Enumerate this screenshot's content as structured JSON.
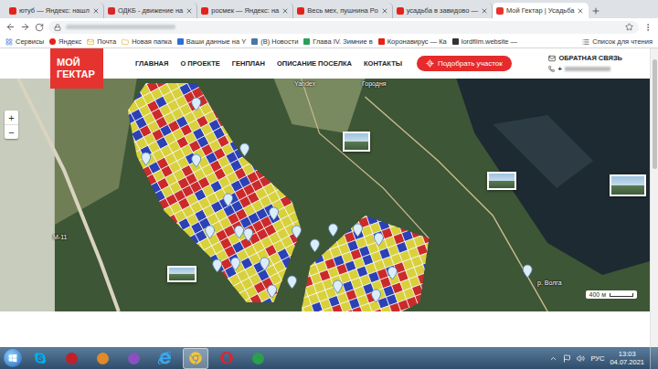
{
  "browser": {
    "tabs": [
      {
        "label": "ютуб — Яндекс: нашл",
        "selected": false
      },
      {
        "label": "ОДКБ - движение на",
        "selected": false
      },
      {
        "label": "росмек — Яндекс: на",
        "selected": false
      },
      {
        "label": "Весь мех, пушнина Ро",
        "selected": false
      },
      {
        "label": "усадьба в завидово —",
        "selected": false
      },
      {
        "label": "Мой Гектар | Усадьба",
        "selected": true
      }
    ],
    "bookmarks": [
      "Сервисы",
      "Яндекс",
      "Почта",
      "Новая папка",
      "Ваши данные на Y",
      "(В) Новости",
      "Глава IV. Зимние в",
      "Коронавирус — Ка",
      "lordfilm.website —"
    ],
    "reading_list": "Список для чтения"
  },
  "site": {
    "logo": [
      "МОЙ",
      "ГЕКТАР"
    ],
    "nav": [
      "ГЛАВНАЯ",
      "О ПРОЕКТЕ",
      "ГЕНПЛАН",
      "ОПИСАНИЕ ПОСЕЛКА",
      "КОНТАКТЫ"
    ],
    "cta": "Подобрать участок",
    "feedback": "ОБРАТНАЯ СВЯЗЬ",
    "phone": "+"
  },
  "map": {
    "labels": [
      "Yandex",
      "Городня",
      "М-11",
      "р. Волга"
    ],
    "zoom_in": "+",
    "zoom_out": "−",
    "scale": "400 м",
    "plot_colors": [
      "#e6dc3c",
      "#d8262a",
      "#2b3fc0"
    ]
  },
  "taskbar": {
    "language": "РУС",
    "time": "13:03",
    "date": "04.07.2021"
  }
}
